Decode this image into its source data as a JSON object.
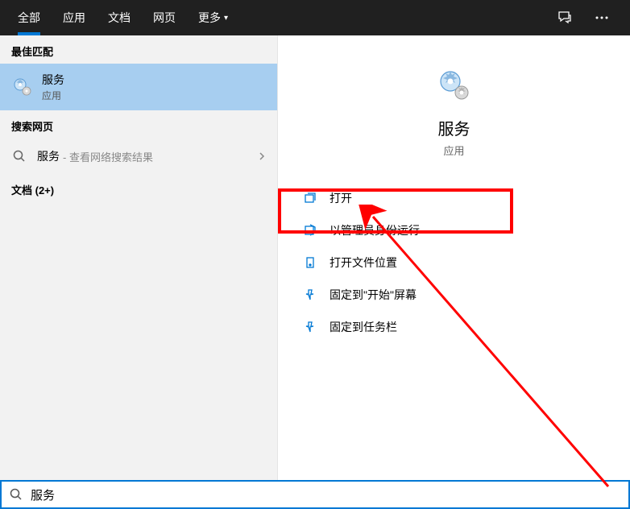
{
  "tabs": {
    "all": "全部",
    "apps": "应用",
    "documents": "文档",
    "web": "网页",
    "more": "更多"
  },
  "sections": {
    "best_match": "最佳匹配",
    "search_web": "搜索网页",
    "documents": "文档 (2+)"
  },
  "result": {
    "title": "服务",
    "subtitle": "应用"
  },
  "web_search": {
    "term": "服务",
    "suffix": "- 查看网络搜索结果"
  },
  "preview": {
    "title": "服务",
    "subtitle": "应用"
  },
  "actions": {
    "open": "打开",
    "run_admin": "以管理员身份运行",
    "open_location": "打开文件位置",
    "pin_start": "固定到\"开始\"屏幕",
    "pin_taskbar": "固定到任务栏"
  },
  "search": {
    "value": "服务"
  }
}
